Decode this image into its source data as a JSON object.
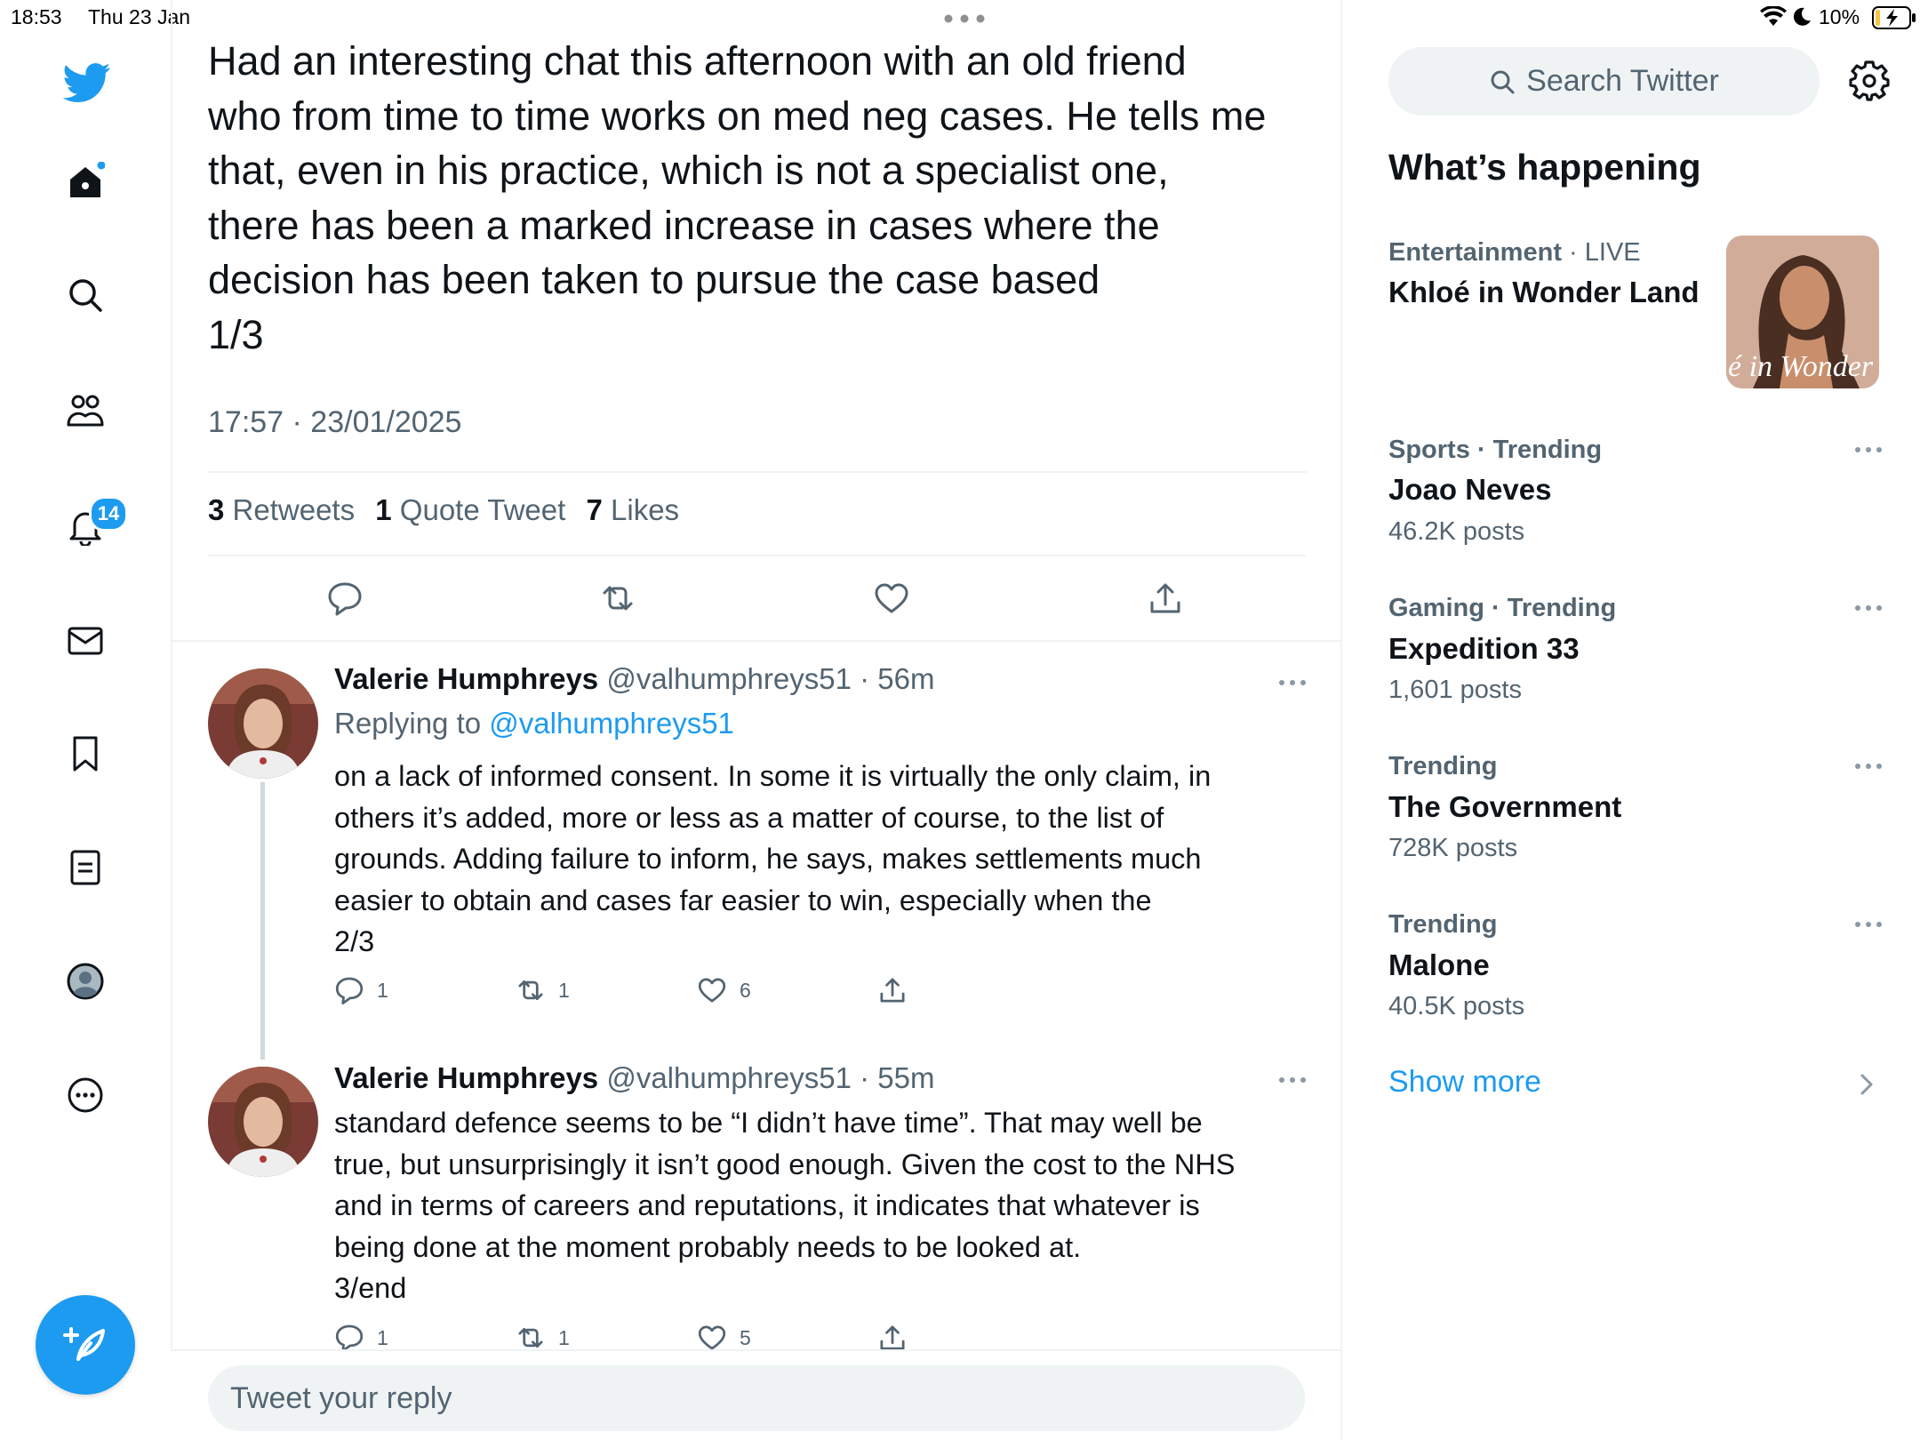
{
  "status_bar": {
    "time": "18:53",
    "date": "Thu 23 Jan",
    "battery": "10%"
  },
  "nav": {
    "notifications_badge": "14"
  },
  "tweet": {
    "text": "Had an interesting chat this afternoon with an old friend\nwho from time to time works on med neg cases. He tells me\nthat, even in his practice, which is not a specialist one,\nthere has been a marked increase in cases where the\ndecision has been taken to pursue the case based\n1/3",
    "timestamp": "17:57 · 23/01/2025",
    "retweets_count": "3",
    "retweets_label": "Retweets",
    "quotes_count": "1",
    "quotes_label": "Quote Tweet",
    "likes_count": "7",
    "likes_label": "Likes"
  },
  "replies": [
    {
      "name": "Valerie Humphreys",
      "handle_time": "@valhumphreys51 · 56m",
      "replying_prefix": "Replying to",
      "replying_handle": "@valhumphreys51",
      "text": "on a lack of informed consent. In some it is virtually the only claim, in\nothers it’s added, more or less as a matter of course, to the list of\ngrounds. Adding failure to inform, he says, makes settlements much\neasier to obtain and cases far easier to win, especially when the\n2/3",
      "reply_count": "1",
      "retweet_count": "1",
      "like_count": "6"
    },
    {
      "name": "Valerie Humphreys",
      "handle_time": "@valhumphreys51 · 55m",
      "text": "standard defence seems to be “I didn’t have time”. That may well be\ntrue, but unsurprisingly it isn’t good enough. Given the cost to the NHS\nand in terms of careers and reputations, it indicates that whatever is\nbeing done at the moment probably needs to be looked at.\n3/end",
      "reply_count": "1",
      "retweet_count": "1",
      "like_count": "5"
    }
  ],
  "reply_box": {
    "placeholder": "Tweet your reply"
  },
  "sidebar": {
    "search_placeholder": "Search Twitter",
    "heading": "What’s happening",
    "featured": {
      "category": "Entertainment",
      "live": "· LIVE",
      "title": "Khloé in Wonder Land",
      "thumb_text": "é in Wonder l"
    },
    "trends": [
      {
        "context": "Sports · Trending",
        "title": "Joao Neves",
        "count": "46.2K posts"
      },
      {
        "context": "Gaming · Trending",
        "title": "Expedition 33",
        "count": "1,601 posts"
      },
      {
        "context": "Trending",
        "title": "The Government",
        "count": "728K posts"
      },
      {
        "context": "Trending",
        "title": "Malone",
        "count": "40.5K posts"
      }
    ],
    "show_more": "Show more"
  },
  "colors": {
    "accent": "#1d9bf0",
    "text_primary": "#0f1419",
    "text_secondary": "#536471",
    "divider": "#eff3f4"
  }
}
